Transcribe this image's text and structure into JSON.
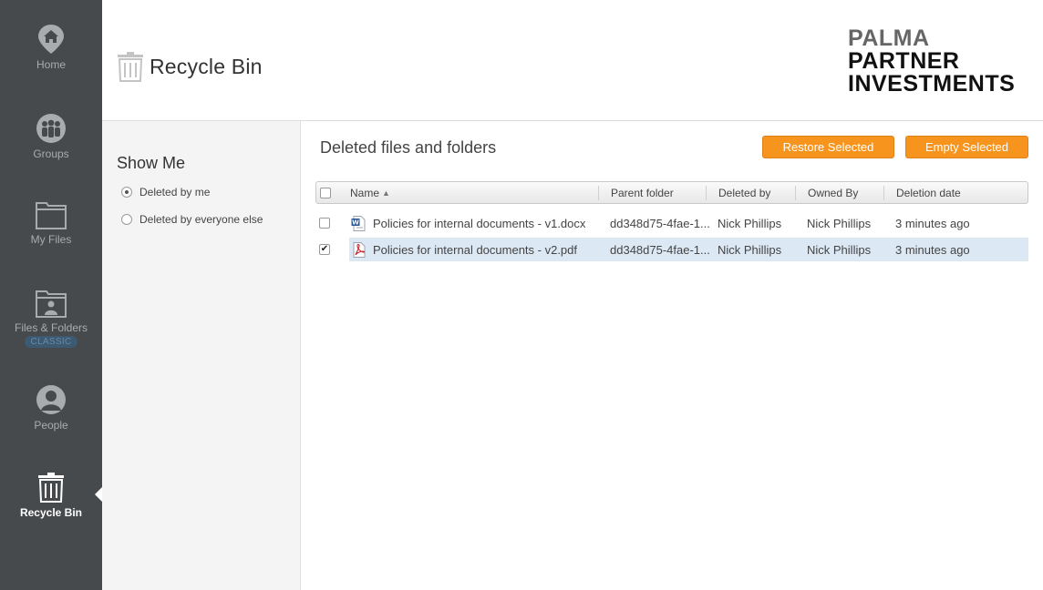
{
  "nav": {
    "home": "Home",
    "groups": "Groups",
    "my_files": "My Files",
    "files_folders": "Files & Folders",
    "classic_badge": "CLASSIC",
    "people": "People",
    "recycle_bin": "Recycle Bin"
  },
  "header": {
    "title": "Recycle Bin",
    "brand_line1": "PALMA",
    "brand_line2": "PARTNER",
    "brand_line3": "INVESTMENTS"
  },
  "filter": {
    "title": "Show Me",
    "options": [
      {
        "label": "Deleted by me",
        "selected": true
      },
      {
        "label": "Deleted by everyone else",
        "selected": false
      }
    ]
  },
  "main": {
    "section_title": "Deleted files and folders",
    "restore_label": "Restore Selected",
    "empty_label": "Empty Selected",
    "columns": {
      "name": "Name",
      "sort_indicator": "▲",
      "parent_folder": "Parent folder",
      "deleted_by": "Deleted by",
      "owned_by": "Owned By",
      "deletion_date": "Deletion date"
    },
    "rows": [
      {
        "checked": false,
        "type": "docx",
        "name": "Policies for internal documents - v1.docx",
        "parent_folder": "dd348d75-4fae-1...",
        "deleted_by": "Nick Phillips",
        "owned_by": "Nick Phillips",
        "deletion_date": "3 minutes ago"
      },
      {
        "checked": true,
        "type": "pdf",
        "name": "Policies for internal documents - v2.pdf",
        "parent_folder": "dd348d75-4fae-1...",
        "deleted_by": "Nick Phillips",
        "owned_by": "Nick Phillips",
        "deletion_date": "3 minutes ago"
      }
    ]
  },
  "colors": {
    "nav_bg": "#474a4d",
    "accent_orange": "#f7941d",
    "selected_row": "#dce8f4"
  }
}
